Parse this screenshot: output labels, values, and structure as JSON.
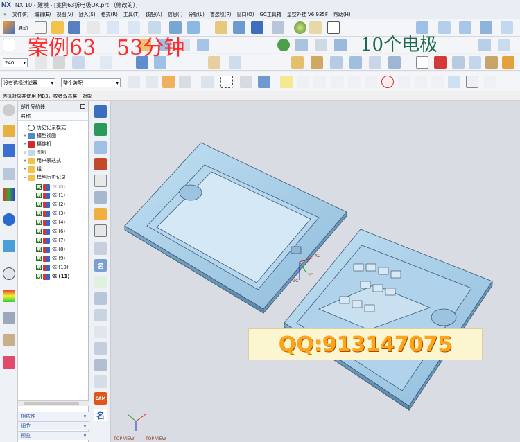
{
  "title": {
    "logo": "NX",
    "text": "NX 10 - 建模 - [案例63拆电极OK.prt （修改的）]"
  },
  "menu": [
    "文件(F)",
    "编辑(E)",
    "视图(V)",
    "插入(S)",
    "格式(R)",
    "工具(T)",
    "装配(A)",
    "信息(I)",
    "分析(L)",
    "首选项(P)",
    "窗口(O)",
    "GC工具箱",
    "星空外挂 V6.935F",
    "帮助(H)"
  ],
  "toolbar": {
    "start_label": "启动",
    "zoom_value": "240",
    "filter_value": "没有选择过滤器",
    "assembly_value": "整个装配"
  },
  "status_text": "选择对象并使用 MB3，或者双击某一对象",
  "navigator": {
    "title": "部件导航器",
    "column": "名称",
    "items": [
      {
        "label": "历史记录模式",
        "level": 1
      },
      {
        "label": "模型视图",
        "level": 1
      },
      {
        "label": "摄像机",
        "level": 1
      },
      {
        "label": "图纸",
        "level": 1
      },
      {
        "label": "用户表达式",
        "level": 1
      },
      {
        "label": "组",
        "level": 1
      },
      {
        "label": "模型历史记录",
        "level": 1
      },
      {
        "label": "体 (0)",
        "level": 2,
        "dim": true
      },
      {
        "label": "体 (1)",
        "level": 2
      },
      {
        "label": "体 (2)",
        "level": 2
      },
      {
        "label": "体 (3)",
        "level": 2
      },
      {
        "label": "体 (4)",
        "level": 2
      },
      {
        "label": "体 (6)",
        "level": 2
      },
      {
        "label": "体 (7)",
        "level": 2
      },
      {
        "label": "体 (8)",
        "level": 2
      },
      {
        "label": "体 (9)",
        "level": 2
      },
      {
        "label": "体 (10)",
        "level": 2
      },
      {
        "label": "体 (11)",
        "level": 2,
        "bold": true
      }
    ],
    "sections": [
      "相依性",
      "细节",
      "预览"
    ]
  },
  "rightbar": {
    "cam_label": "CAM",
    "name_label": "名"
  },
  "overlay": {
    "case_text": "案例63　53分钟",
    "electrode_text": "10个电极",
    "qq_text": "QQ:913147075"
  },
  "viewport": {
    "view_label_1": "TOP VIEW",
    "view_label_2": "TOP VIEW",
    "axis_x": "XC",
    "axis_y": "YC",
    "axis_z": "ZC"
  },
  "colors": {
    "model": "#a6cde6",
    "model_edge": "#3a5a74",
    "background": "#d9dde3"
  }
}
